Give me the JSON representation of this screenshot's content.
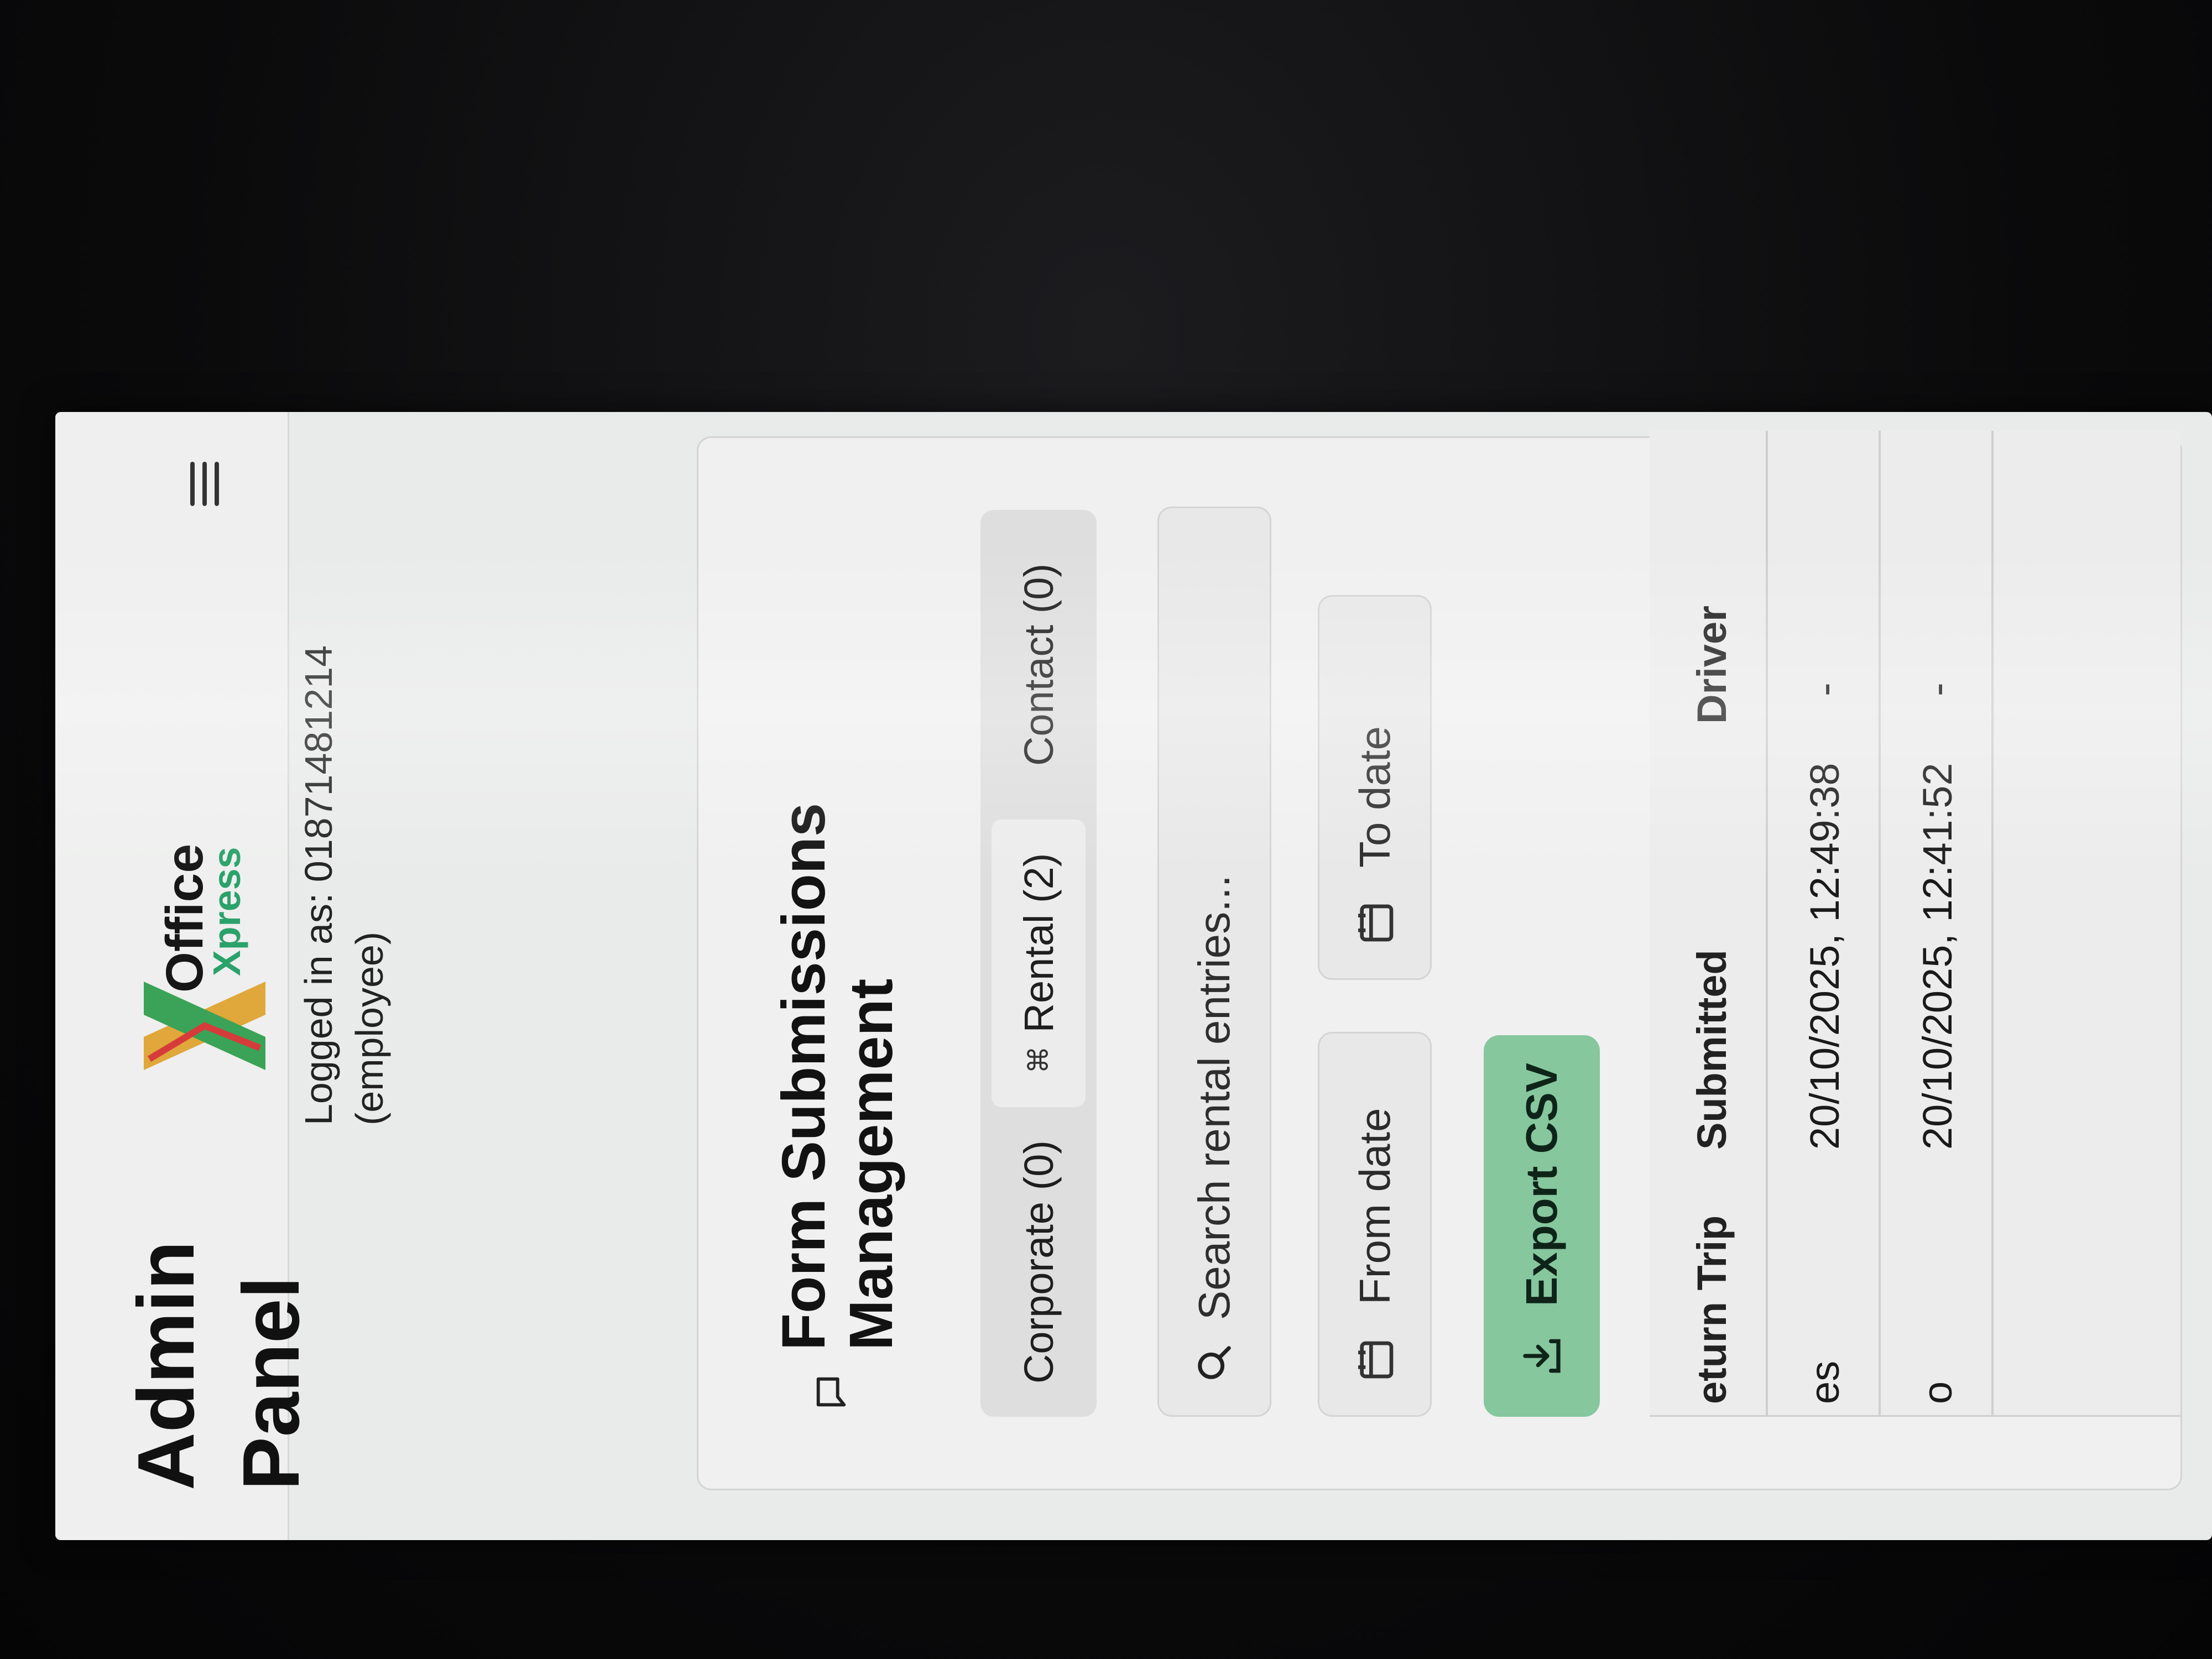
{
  "app": {
    "title": "Admin Panel",
    "logo_line1": "Office",
    "logo_line2": "Xpress",
    "logged_in_as": "Logged in as: 01871481214",
    "role": "(employee)"
  },
  "card": {
    "title": "Form Submissions Management"
  },
  "tabs": [
    {
      "label": "Corporate (0)"
    },
    {
      "label": "Rental (2)"
    },
    {
      "label": "Contact (0)"
    }
  ],
  "search": {
    "placeholder": "Search rental entries..."
  },
  "filters": {
    "from_date": "From date",
    "to_date": "To date"
  },
  "export": {
    "label": "Export CSV"
  },
  "table": {
    "columns": [
      "eturn Trip",
      "Submitted",
      "Driver"
    ],
    "rows": [
      {
        "return_trip": "es",
        "submitted": "20/10/2025, 12:49:38",
        "driver": "-"
      },
      {
        "return_trip": "o",
        "submitted": "20/10/2025, 12:41:52",
        "driver": "-"
      }
    ]
  },
  "icons": {
    "menu": "hamburger-menu-icon",
    "title": "message-square-icon",
    "rental_tab": "car-icon",
    "search": "search-icon",
    "calendar": "calendar-icon",
    "export": "download-icon"
  },
  "colors": {
    "accent": "#86c79e",
    "logo_green": "#2aa26a"
  }
}
